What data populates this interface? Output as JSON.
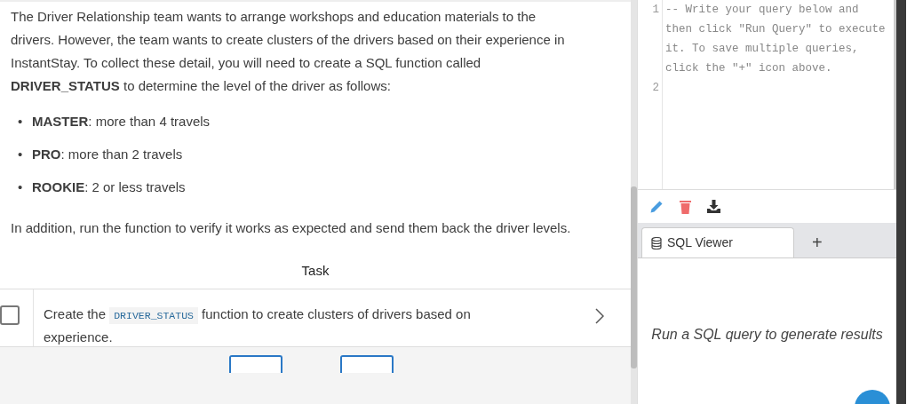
{
  "instructions": {
    "intro": "The Driver Relationship team wants to arrange workshops and education materials to the drivers. However, the team wants to create clusters of the drivers based on their experience in InstantStay. To collect these detail, you will need to create a SQL function called **DRIVER_STATUS** to determine the level of the driver as follows:",
    "levels": [
      {
        "marker": "•",
        "name": "MASTER",
        "text": ": more than 4 travels"
      },
      {
        "marker": "•",
        "name": "PRO",
        "text": ": more than 2 travels"
      },
      {
        "marker": "•",
        "name": "ROOKIE",
        "text": ": 2 or less travels"
      }
    ],
    "outro": "In addition, run the function to verify it works as expected and send them back the driver levels."
  },
  "task": {
    "heading": "Task",
    "items": [
      {
        "checked": false,
        "parts": [
          {
            "kind": "text",
            "text": "Create the "
          },
          {
            "kind": "code",
            "text": "DRIVER_STATUS"
          },
          {
            "kind": "text",
            "text": " function to create clusters of drivers based on experience."
          }
        ]
      }
    ]
  },
  "editor": {
    "lines": [
      {
        "number": "1",
        "code": "-- Write your query below and then click \"Run Query\" to execute it. To save multiple queries, click the \"+\" icon above."
      },
      {
        "number": "2"
      }
    ]
  },
  "viewer": {
    "tabs": [
      {
        "label": "SQL Viewer",
        "selected": true
      }
    ],
    "add_tab": "+",
    "empty_message": "Run a SQL query to generate results"
  }
}
